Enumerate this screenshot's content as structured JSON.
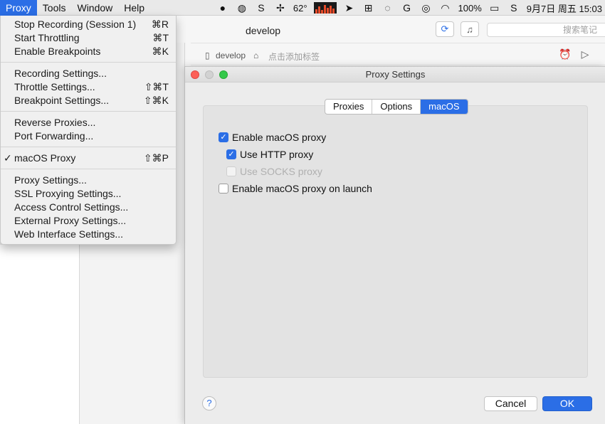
{
  "menubar": {
    "menus": [
      "Proxy",
      "Tools",
      "Window",
      "Help"
    ],
    "status": {
      "temperature": "62°",
      "battery": "100%",
      "datetime": "9月7日 周五 15:03"
    }
  },
  "dropdown": {
    "groups": [
      [
        {
          "label": "Stop Recording (Session 1)",
          "shortcut": "⌘R"
        },
        {
          "label": "Start Throttling",
          "shortcut": "⌘T"
        },
        {
          "label": "Enable Breakpoints",
          "shortcut": "⌘K"
        }
      ],
      [
        {
          "label": "Recording Settings...",
          "shortcut": ""
        },
        {
          "label": "Throttle Settings...",
          "shortcut": "⇧⌘T"
        },
        {
          "label": "Breakpoint Settings...",
          "shortcut": "⇧⌘K"
        }
      ],
      [
        {
          "label": "Reverse Proxies...",
          "shortcut": ""
        },
        {
          "label": "Port Forwarding...",
          "shortcut": ""
        }
      ],
      [
        {
          "label": "macOS Proxy",
          "shortcut": "⇧⌘P",
          "checked": true
        }
      ],
      [
        {
          "label": "Proxy Settings...",
          "shortcut": ""
        },
        {
          "label": "SSL Proxying Settings...",
          "shortcut": ""
        },
        {
          "label": "Access Control Settings...",
          "shortcut": ""
        },
        {
          "label": "External Proxy Settings...",
          "shortcut": ""
        },
        {
          "label": "Web Interface Settings...",
          "shortcut": ""
        }
      ]
    ]
  },
  "background_window": {
    "title": "develop",
    "search_placeholder": "搜索笔记",
    "notebook": "develop",
    "tag_placeholder": "点击添加标签"
  },
  "dialog": {
    "title": "Proxy Settings",
    "tabs": [
      {
        "label": "Proxies",
        "selected": false
      },
      {
        "label": "Options",
        "selected": false
      },
      {
        "label": "macOS",
        "selected": true
      }
    ],
    "options": {
      "enable_proxy": {
        "label": "Enable macOS proxy",
        "checked": true
      },
      "use_http": {
        "label": "Use HTTP proxy",
        "checked": true
      },
      "use_socks": {
        "label": "Use SOCKS proxy",
        "checked": false,
        "disabled": true
      },
      "enable_on_launch": {
        "label": "Enable macOS proxy on launch",
        "checked": false
      }
    },
    "help_label": "?",
    "cancel_label": "Cancel",
    "ok_label": "OK"
  }
}
